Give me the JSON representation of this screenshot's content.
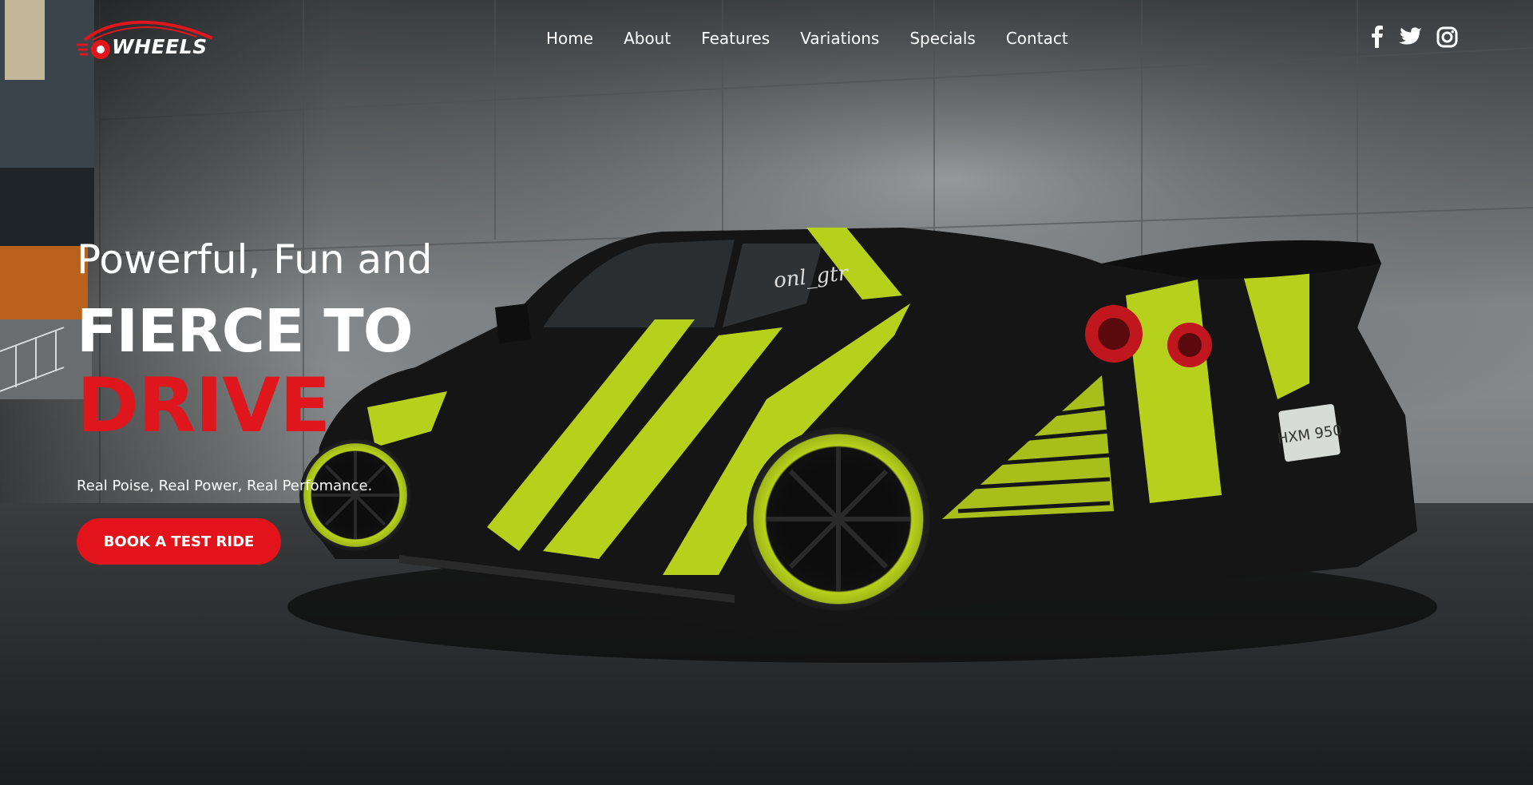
{
  "brand": {
    "name": "WHEELS",
    "logo_icon": "car-wheel-logo-icon"
  },
  "nav": {
    "items": [
      {
        "label": "Home"
      },
      {
        "label": "About"
      },
      {
        "label": "Features"
      },
      {
        "label": "Variations"
      },
      {
        "label": "Specials"
      },
      {
        "label": "Contact"
      }
    ]
  },
  "social": {
    "icons": [
      "facebook-icon",
      "twitter-icon",
      "instagram-icon"
    ]
  },
  "hero": {
    "subtitle": "Powerful, Fun and",
    "headline_white": "FIERCE TO",
    "headline_red": "DRIVE",
    "tagline": "Real Poise, Real Power, Real Perfomance.",
    "cta_label": "BOOK A TEST RIDE",
    "car_plate": "HXM 950",
    "windshield_decal": "onl_gtr"
  },
  "colors": {
    "accent_red": "#e0161d",
    "car_lime": "#b6d11c",
    "car_body": "#151515",
    "text": "#ffffff"
  }
}
